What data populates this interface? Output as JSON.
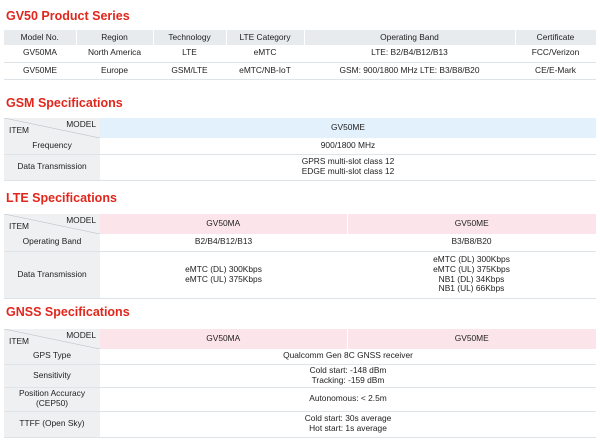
{
  "product_series": {
    "title": "GV50 Product Series",
    "headers": [
      "Model No.",
      "Region",
      "Technology",
      "LTE Category",
      "Operating Band",
      "Certificate"
    ],
    "rows": [
      [
        "GV50MA",
        "North America",
        "LTE",
        "eMTC",
        "LTE: B2/B4/B12/B13",
        "FCC/Verizon"
      ],
      [
        "GV50ME",
        "Europe",
        "GSM/LTE",
        "eMTC/NB-IoT",
        "GSM: 900/1800 MHz   LTE: B3/B8/B20",
        "CE/E-Mark"
      ]
    ]
  },
  "gsm": {
    "title": "GSM Specifications",
    "corner_model": "MODEL",
    "corner_item": "ITEM",
    "model": "GV50ME",
    "rows": [
      {
        "label": "Frequency",
        "values": [
          "900/1800 MHz"
        ]
      },
      {
        "label": "Data Transmission",
        "values": [
          "GPRS multi-slot class 12",
          "EDGE multi-slot class 12"
        ]
      }
    ]
  },
  "lte": {
    "title": "LTE Specifications",
    "corner_model": "MODEL",
    "corner_item": "ITEM",
    "models": [
      "GV50MA",
      "GV50ME"
    ],
    "rows": [
      {
        "label": "Operating Band",
        "ma": [
          "B2/B4/B12/B13"
        ],
        "me": [
          "B3/B8/B20"
        ]
      },
      {
        "label": "Data Transmission",
        "ma": [
          "eMTC (DL) 300Kbps",
          "eMTC (UL) 375Kbps"
        ],
        "me": [
          "eMTC (DL) 300Kbps",
          "eMTC (UL) 375Kbps",
          "NB1 (DL) 34Kbps",
          "NB1 (UL) 66Kbps"
        ]
      }
    ]
  },
  "gnss": {
    "title": "GNSS Specifications",
    "corner_model": "MODEL",
    "corner_item": "ITEM",
    "models": [
      "GV50MA",
      "GV50ME"
    ],
    "rows": [
      {
        "label": [
          "GPS Type"
        ],
        "values": [
          "Qualcomm Gen 8C GNSS receiver"
        ]
      },
      {
        "label": [
          "Sensitivity"
        ],
        "values": [
          "Cold start: -148 dBm",
          "Tracking: -159 dBm"
        ]
      },
      {
        "label": [
          "Position Accuracy",
          "(CEP50)"
        ],
        "values": [
          "Autonomous: < 2.5m"
        ]
      },
      {
        "label": [
          "TTFF (Open Sky)"
        ],
        "values": [
          "Cold start: 30s average",
          "Hot start: 1s average"
        ]
      }
    ]
  },
  "colors": {
    "title_red": "#e1261c",
    "header_gray": "#e7ebee",
    "label_gray": "#eef0f2",
    "gsm_blue": "#e2f1fb",
    "lte_pink": "#fbe5ea",
    "gnss_pink": "#fbe5ea"
  }
}
